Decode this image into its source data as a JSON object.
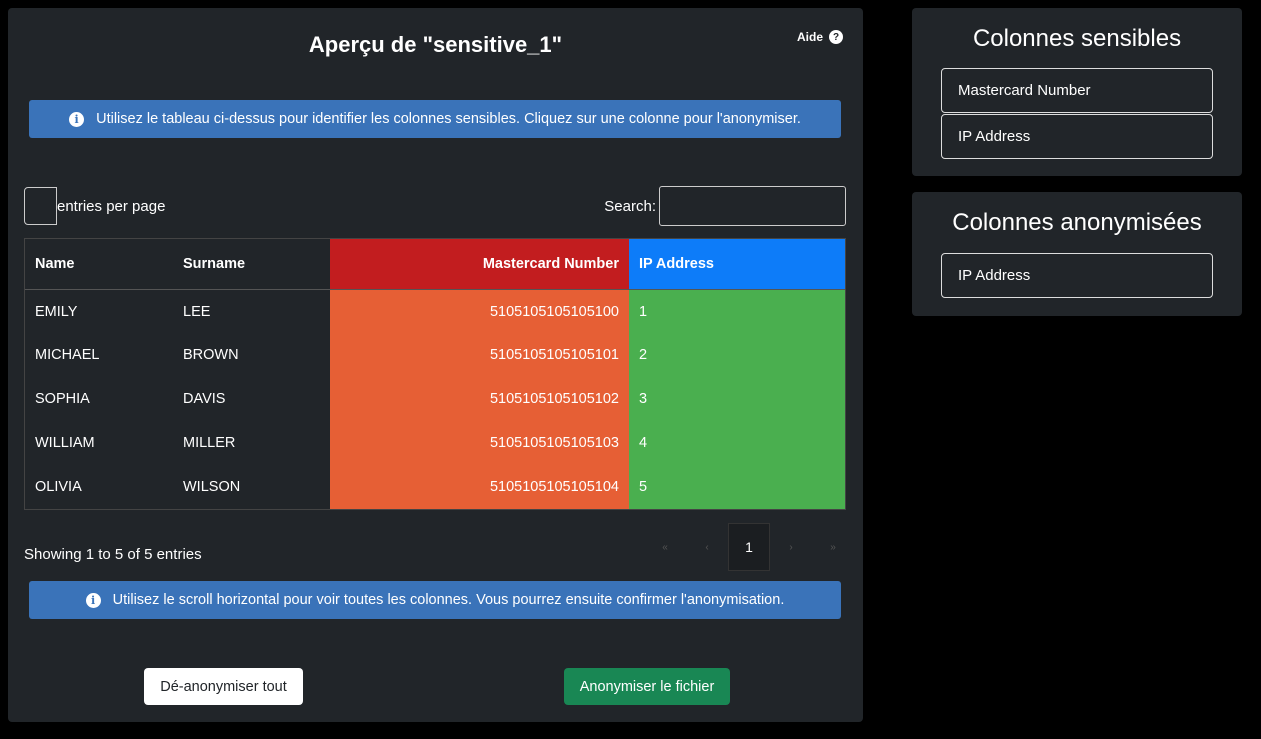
{
  "main": {
    "title": "Aperçu de \"sensitive_1\"",
    "help_label": "Aide",
    "help_icon": "?",
    "info_icon": "i",
    "alert_top": "Utilisez le tableau ci-dessus pour identifier les colonnes sensibles. Cliquez sur une colonne pour l'anonymiser.",
    "alert_bottom": "Utilisez le scroll horizontal pour voir toutes les colonnes. Vous pourrez ensuite confirmer l'anonymisation.",
    "length_label": "entries per page",
    "search_label": "Search:",
    "search_value": "",
    "columns": [
      "Name",
      "Surname",
      "Mastercard Number",
      "IP Address"
    ],
    "rows": [
      [
        "EMILY",
        "LEE",
        "5105105105105100",
        "1"
      ],
      [
        "MICHAEL",
        "BROWN",
        "5105105105105101",
        "2"
      ],
      [
        "SOPHIA",
        "DAVIS",
        "5105105105105102",
        "3"
      ],
      [
        "WILLIAM",
        "MILLER",
        "5105105105105103",
        "4"
      ],
      [
        "OLIVIA",
        "WILSON",
        "5105105105105104",
        "5"
      ]
    ],
    "info_text": "Showing 1 to 5 of 5 entries",
    "pager": {
      "first": "«",
      "prev": "‹",
      "current": "1",
      "next": "›",
      "last": "»"
    },
    "btn_deanonymize": "Dé-anonymiser tout",
    "btn_anonymize": "Anonymiser le fichier"
  },
  "sensitive": {
    "title": "Colonnes sensibles",
    "items": [
      "Mastercard Number",
      "IP Address"
    ]
  },
  "anonymized": {
    "title": "Colonnes anonymisées",
    "items": [
      "IP Address"
    ]
  },
  "colors": {
    "sensitive_header": "#c21d1f",
    "sensitive_cell": "#e65f35",
    "anonymized_header": "#0d7cf9",
    "anonymized_cell": "#4aaf4f",
    "alert": "#3a73b9",
    "primary_button": "#198754"
  }
}
